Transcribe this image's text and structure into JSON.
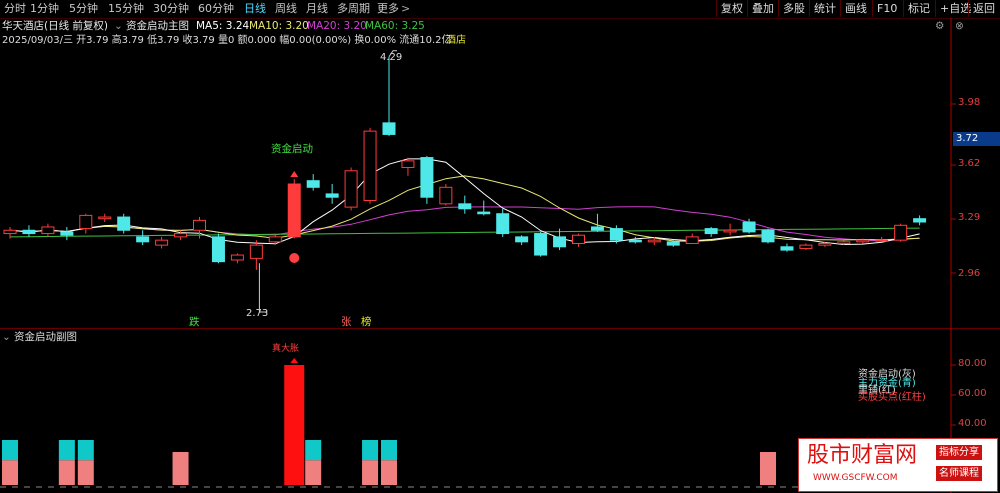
{
  "toolbar": {
    "periods": [
      "分时",
      "1分钟",
      "5分钟",
      "15分钟",
      "30分钟",
      "60分钟",
      "日线",
      "周线",
      "月线",
      "多周期",
      "更多"
    ],
    "more_arrow": ">",
    "active_period": "日线",
    "right_buttons": [
      "复权",
      "叠加",
      "多股",
      "统计",
      "画线",
      "F10",
      "标记",
      "+自选",
      "返回"
    ]
  },
  "header": {
    "stock_name": "华天酒店(日线 前复权)",
    "indicator_name": "资金启动主图",
    "ma5": "MA5: 3.24",
    "ma10": "MA10: 3.20",
    "ma20": "MA20: 3.20",
    "ma60": "MA60: 3.25",
    "info": "2025/09/03/三 开3.79 高3.79 低3.79 收3.79 量0 额0.000 幅0.00(0.00%) 换0.00% 流通10.2亿",
    "sector": "酒店"
  },
  "main_chart": {
    "y_ticks": [
      "3.98",
      "3.62",
      "3.29",
      "2.96"
    ],
    "current_price": "3.72",
    "high_label": "4.29",
    "low_label": "2.73",
    "signal_label": "资金启动",
    "marker_die": "跌",
    "marker_zhang": "张",
    "marker_bang": "榜"
  },
  "sub_chart": {
    "title": "资金启动副图",
    "y_ticks": [
      "80.00",
      "60.00",
      "40.00"
    ],
    "bar_top_label": "真大胀",
    "legend": [
      "资金启动(灰)",
      "主力资金(青)",
      "里铺(红)",
      "买股买点(红柱)"
    ]
  },
  "watermark": {
    "title": "股市财富网",
    "url": "WWW.GSCFW.COM",
    "badge1": "指标分享",
    "badge2": "名师课程"
  },
  "colors": {
    "up": "#ff3b3b",
    "down": "#4ee8e8",
    "ma5": "#ffffff",
    "ma10": "#e8e870",
    "ma20": "#d040d0",
    "ma60": "#40c040",
    "axis": "#b00000"
  },
  "chart_data": {
    "type": "candlestick",
    "candles": [
      [
        3.22,
        3.26,
        3.19,
        3.24
      ],
      [
        3.24,
        3.27,
        3.2,
        3.22
      ],
      [
        3.22,
        3.28,
        3.2,
        3.26
      ],
      [
        3.23,
        3.26,
        3.18,
        3.21
      ],
      [
        3.25,
        3.34,
        3.22,
        3.33
      ],
      [
        3.31,
        3.34,
        3.29,
        3.32
      ],
      [
        3.32,
        3.34,
        3.22,
        3.24
      ],
      [
        3.2,
        3.24,
        3.15,
        3.17
      ],
      [
        3.15,
        3.2,
        3.13,
        3.18
      ],
      [
        3.2,
        3.24,
        3.18,
        3.22
      ],
      [
        3.24,
        3.32,
        3.19,
        3.3
      ],
      [
        3.2,
        3.22,
        3.04,
        3.05
      ],
      [
        3.06,
        3.1,
        3.04,
        3.09
      ],
      [
        3.07,
        3.18,
        3.0,
        3.15
      ],
      [
        3.17,
        3.22,
        3.15,
        3.2
      ],
      [
        3.2,
        3.55,
        3.19,
        3.52
      ],
      [
        3.54,
        3.58,
        3.48,
        3.5
      ],
      [
        3.46,
        3.52,
        3.4,
        3.44
      ],
      [
        3.38,
        3.62,
        3.36,
        3.6
      ],
      [
        3.42,
        3.86,
        3.4,
        3.84
      ],
      [
        3.89,
        4.29,
        3.81,
        3.82
      ],
      [
        3.62,
        3.68,
        3.57,
        3.66
      ],
      [
        3.68,
        3.69,
        3.4,
        3.44
      ],
      [
        3.4,
        3.52,
        3.39,
        3.5
      ],
      [
        3.4,
        3.45,
        3.34,
        3.37
      ],
      [
        3.35,
        3.42,
        3.33,
        3.34
      ],
      [
        3.34,
        3.37,
        3.2,
        3.22
      ],
      [
        3.2,
        3.21,
        3.15,
        3.17
      ],
      [
        3.22,
        3.23,
        3.08,
        3.09
      ],
      [
        3.2,
        3.25,
        3.12,
        3.14
      ],
      [
        3.16,
        3.22,
        3.14,
        3.21
      ],
      [
        3.26,
        3.34,
        3.23,
        3.24
      ],
      [
        3.25,
        3.27,
        3.16,
        3.18
      ],
      [
        3.18,
        3.2,
        3.16,
        3.17
      ],
      [
        3.17,
        3.2,
        3.15,
        3.18
      ],
      [
        3.17,
        3.18,
        3.14,
        3.15
      ],
      [
        3.16,
        3.22,
        3.16,
        3.2
      ],
      [
        3.25,
        3.26,
        3.2,
        3.22
      ],
      [
        3.23,
        3.28,
        3.21,
        3.24
      ],
      [
        3.29,
        3.31,
        3.22,
        3.23
      ],
      [
        3.24,
        3.25,
        3.16,
        3.17
      ],
      [
        3.14,
        3.16,
        3.11,
        3.12
      ],
      [
        3.13,
        3.16,
        3.12,
        3.15
      ],
      [
        3.15,
        3.17,
        3.14,
        3.16
      ],
      [
        3.16,
        3.18,
        3.15,
        3.17
      ],
      [
        3.17,
        3.19,
        3.16,
        3.18
      ],
      [
        3.18,
        3.2,
        3.17,
        3.18
      ],
      [
        3.18,
        3.28,
        3.17,
        3.27
      ],
      [
        3.31,
        3.33,
        3.27,
        3.29
      ]
    ],
    "sub_bars": [
      [
        0,
        30,
        "cyan_pink"
      ],
      [
        3,
        30,
        "cyan_pink"
      ],
      [
        4,
        30,
        "cyan_pink"
      ],
      [
        9,
        22,
        "pink"
      ],
      [
        15,
        80,
        "red"
      ],
      [
        16,
        30,
        "cyan_pink"
      ],
      [
        19,
        30,
        "cyan_pink"
      ],
      [
        20,
        30,
        "cyan_pink"
      ],
      [
        40,
        22,
        "pink"
      ]
    ]
  }
}
